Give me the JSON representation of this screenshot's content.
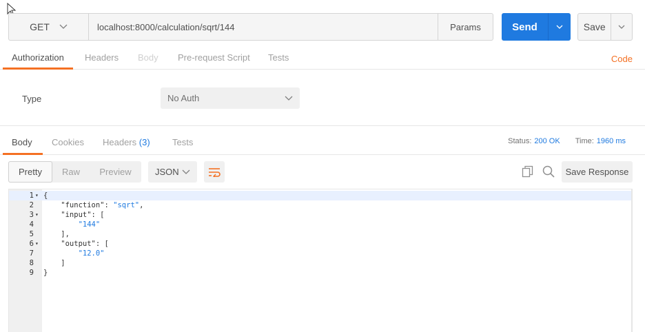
{
  "request": {
    "method": "GET",
    "url": "localhost:8000/calculation/sqrt/144",
    "params_label": "Params",
    "send_label": "Send",
    "save_label": "Save"
  },
  "request_tabs": {
    "authorization": "Authorization",
    "headers": "Headers",
    "body": "Body",
    "prerequest": "Pre-request Script",
    "tests": "Tests",
    "code": "Code"
  },
  "auth": {
    "type_label": "Type",
    "selected": "No Auth"
  },
  "response_tabs": {
    "body": "Body",
    "cookies": "Cookies",
    "headers": "Headers",
    "headers_count": "(3)",
    "tests": "Tests"
  },
  "status": {
    "status_label": "Status:",
    "status_value": "200 OK",
    "time_label": "Time:",
    "time_value": "1960 ms"
  },
  "toolbar": {
    "pretty": "Pretty",
    "raw": "Raw",
    "preview": "Preview",
    "format": "JSON",
    "save_response": "Save Response"
  },
  "editor": {
    "lines": [
      {
        "n": "1",
        "text": "{"
      },
      {
        "n": "2",
        "text": "    \"function\": ",
        "str": "\"sqrt\"",
        "tail": ","
      },
      {
        "n": "3",
        "text": "    \"input\": ["
      },
      {
        "n": "4",
        "text": "        ",
        "str": "\"144\"",
        "tail": ""
      },
      {
        "n": "5",
        "text": "    ],"
      },
      {
        "n": "6",
        "text": "    \"output\": ["
      },
      {
        "n": "7",
        "text": "        ",
        "str": "\"12.0\"",
        "tail": ""
      },
      {
        "n": "8",
        "text": "    ]"
      },
      {
        "n": "9",
        "text": "}"
      }
    ]
  },
  "colors": {
    "accent": "#f47023",
    "primary": "#1f7ae0"
  }
}
